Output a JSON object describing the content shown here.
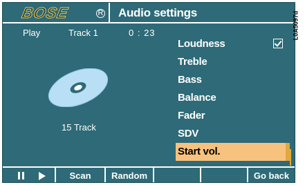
{
  "header": {
    "brand": "BOSE",
    "title": "Audio settings"
  },
  "now_playing": {
    "status": "Play",
    "track": "Track 1",
    "time": "0 : 23",
    "track_count": "15 Track"
  },
  "menu": {
    "items": [
      {
        "label": "Loudness",
        "checked": true
      },
      {
        "label": "Treble"
      },
      {
        "label": "Bass"
      },
      {
        "label": "Balance"
      },
      {
        "label": "Fader"
      },
      {
        "label": "SDV"
      },
      {
        "label": "Start vol.",
        "selected": true
      }
    ]
  },
  "softkeys": {
    "pause_icon": "pause-icon",
    "play_icon": "play-icon",
    "scan": "Scan",
    "random": "Random",
    "back": "Go back"
  },
  "figure_code": "L0A5097d",
  "colors": {
    "screen_bg": "#2e6a77",
    "highlight": "#f6c27d",
    "highlight_edge": "#e0a93a",
    "text": "#ffffff"
  }
}
